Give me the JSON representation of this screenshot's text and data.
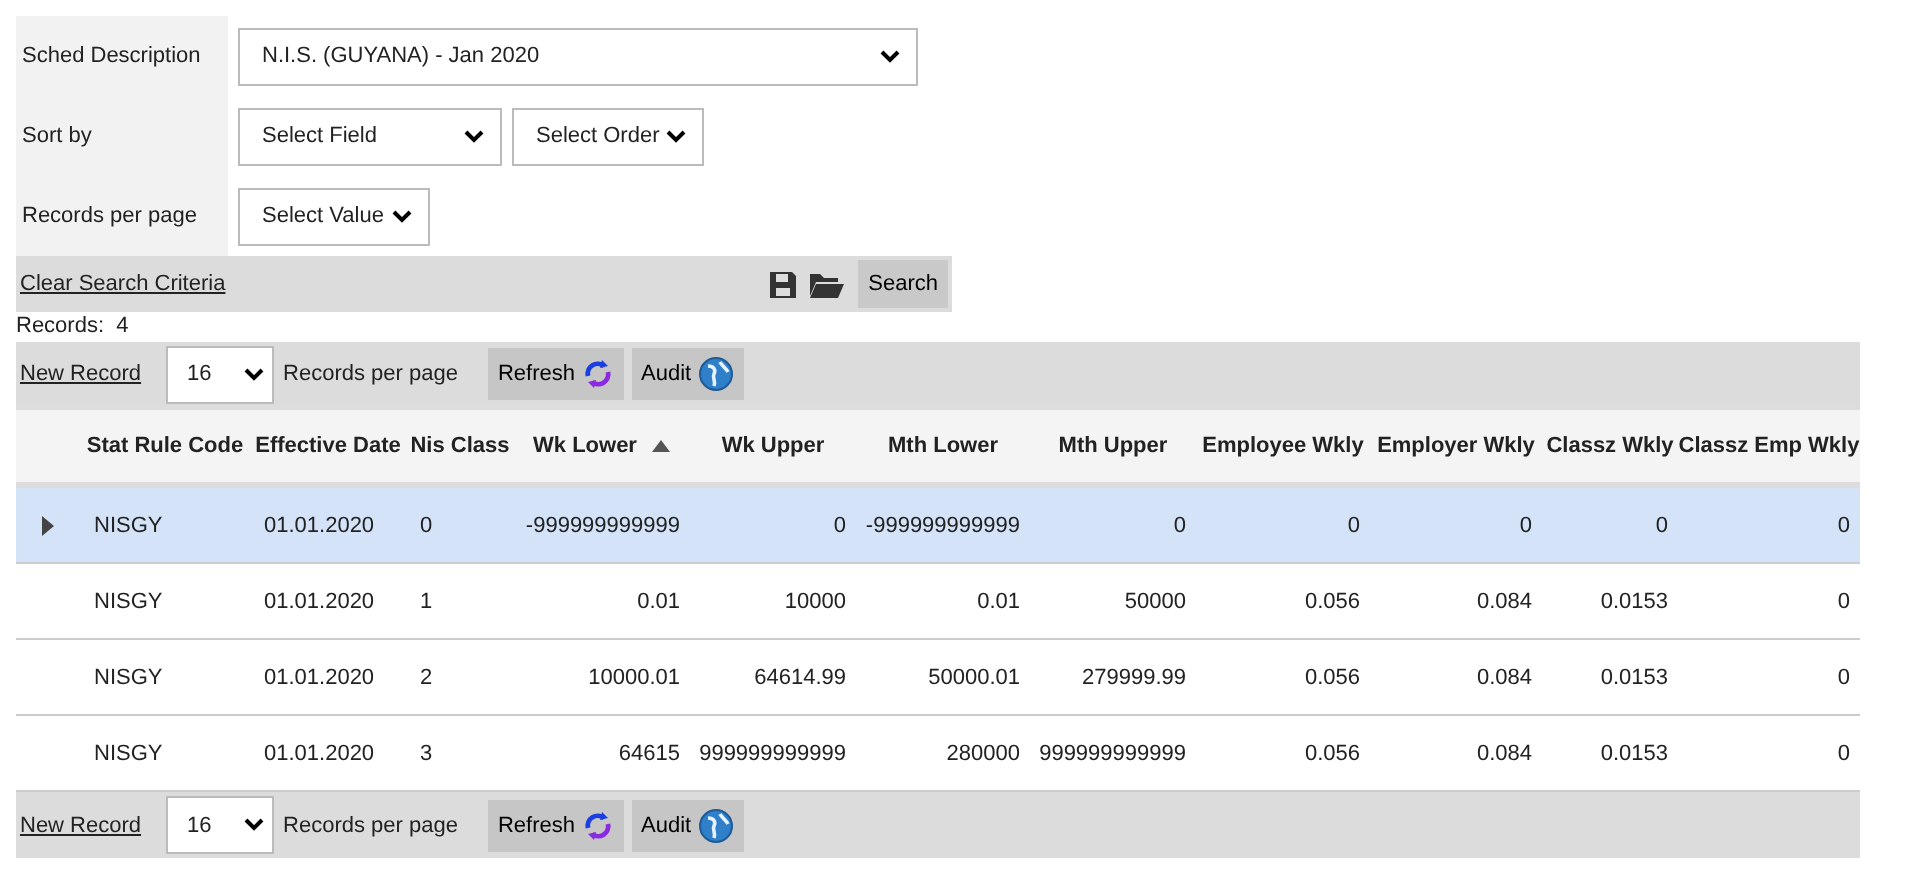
{
  "search": {
    "fields": [
      {
        "label": "Sched Description",
        "selects": [
          {
            "value": "N.I.S. (GUYANA) - Jan 2020",
            "kind": "wide"
          }
        ]
      },
      {
        "label": "Sort by",
        "selects": [
          {
            "value": "Select Field",
            "kind": "medium"
          },
          {
            "value": "Select Order",
            "kind": "small"
          }
        ]
      },
      {
        "label": "Records per page",
        "selects": [
          {
            "value": "Select Value",
            "kind": "small"
          }
        ]
      }
    ],
    "clear_link": "Clear Search Criteria",
    "search_button": "Search"
  },
  "records_count": "Records:  4",
  "toolbars": [
    {
      "new_record": "New Record",
      "page_size": "16",
      "page_size_label": "Records per page",
      "refresh": "Refresh",
      "audit": "Audit"
    }
  ],
  "table": {
    "columns": [
      {
        "label": "Stat Rule Code",
        "sorted": false
      },
      {
        "label": "Effective Date",
        "sorted": false
      },
      {
        "label": "Nis Class",
        "sorted": false
      },
      {
        "label": "Wk Lower",
        "sorted": true
      },
      {
        "label": "Wk Upper",
        "sorted": false
      },
      {
        "label": "Mth Lower",
        "sorted": false
      },
      {
        "label": "Mth Upper",
        "sorted": false
      },
      {
        "label": "Employee Wkly",
        "sorted": false
      },
      {
        "label": "Employer Wkly",
        "sorted": false
      },
      {
        "label": "Classz Wkly",
        "sorted": false
      },
      {
        "label": "Classz Emp Wkly",
        "sorted": false
      }
    ],
    "rows": [
      {
        "selected": true,
        "cells": [
          "NISGY",
          "01.01.2020",
          "0",
          "-999999999999",
          "0",
          "-999999999999",
          "0",
          "0",
          "0",
          "0",
          "0"
        ]
      },
      {
        "selected": false,
        "cells": [
          "NISGY",
          "01.01.2020",
          "1",
          "0.01",
          "10000",
          "0.01",
          "50000",
          "0.056",
          "0.084",
          "0.0153",
          "0"
        ]
      },
      {
        "selected": false,
        "cells": [
          "NISGY",
          "01.01.2020",
          "2",
          "10000.01",
          "64614.99",
          "50000.01",
          "279999.99",
          "0.056",
          "0.084",
          "0.0153",
          "0"
        ]
      },
      {
        "selected": false,
        "cells": [
          "NISGY",
          "01.01.2020",
          "3",
          "64615",
          "999999999999",
          "280000",
          "999999999999",
          "0.056",
          "0.084",
          "0.0153",
          "0"
        ]
      }
    ]
  },
  "bottom_toolbar": {
    "new_record": "New Record",
    "page_size": "16",
    "page_size_label": "Records per page",
    "refresh": "Refresh",
    "audit": "Audit"
  }
}
